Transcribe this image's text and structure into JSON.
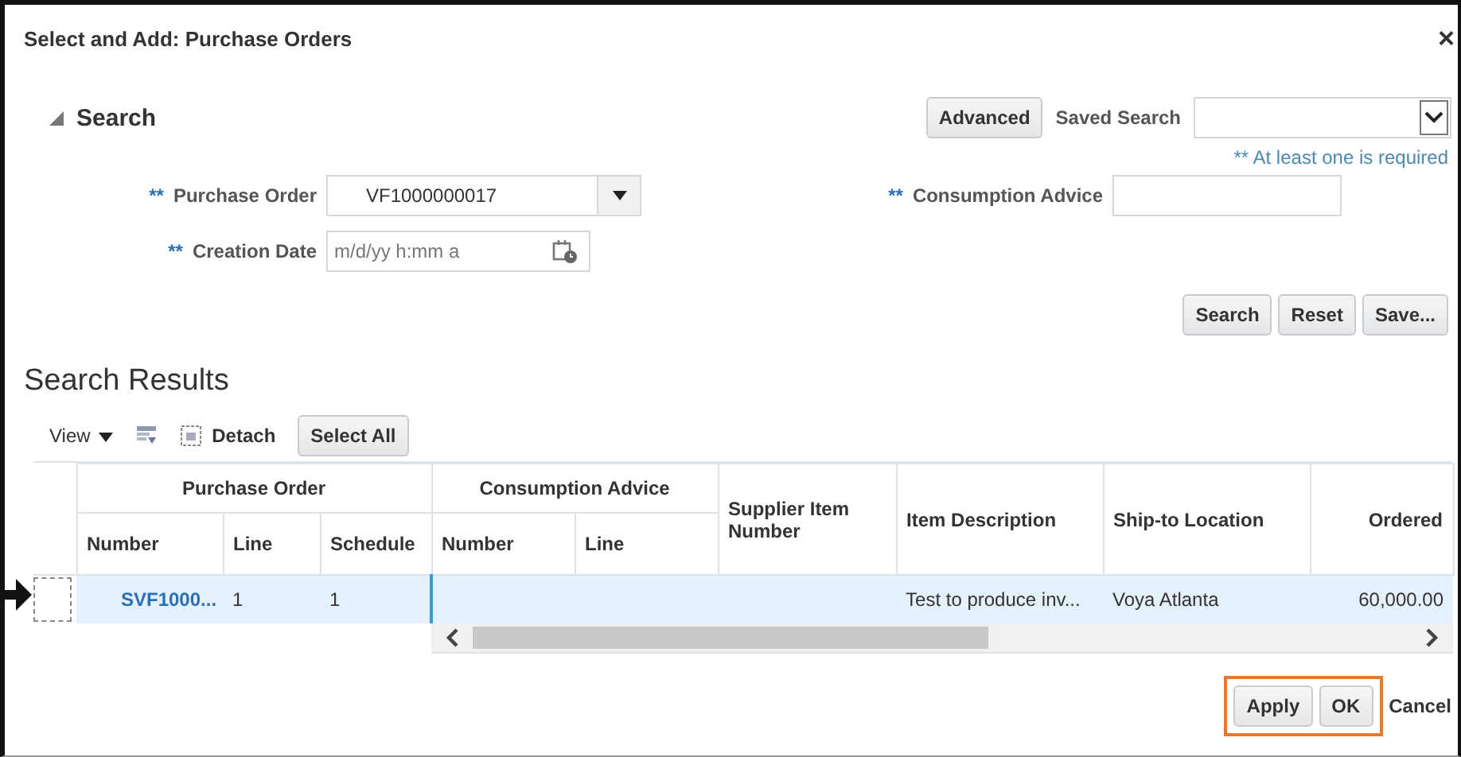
{
  "window": {
    "title": "Select and Add: Purchase Orders",
    "close": "×"
  },
  "search": {
    "title": "Search",
    "expanded": true,
    "advanced": "Advanced",
    "saved_search_label": "Saved Search",
    "required_note": "** At least one is required",
    "fields": [
      {
        "kind": "combo",
        "marker": "**",
        "label": "Purchase Order",
        "value": "VF1000000017"
      },
      {
        "kind": "date",
        "marker": "**",
        "label": "Creation Date",
        "placeholder": "m/d/yy h:mm a"
      },
      {
        "kind": "text",
        "marker": "**",
        "label": "Consumption Advice"
      }
    ],
    "buttons": [
      "Search",
      "Reset",
      "Save..."
    ]
  },
  "results": {
    "title": "Search Results",
    "toolbar": {
      "view": "View",
      "detach": "Detach",
      "select_all": "Select All"
    },
    "column_groups": [
      {
        "label": "Purchase Order",
        "columns": [
          "Number",
          "Line",
          "Schedule"
        ]
      },
      {
        "label": "Consumption Advice",
        "columns": [
          "Number",
          "Line"
        ]
      },
      {
        "label": "Supplier Item Number"
      },
      {
        "label": "Item Description"
      },
      {
        "label": "Ship-to Location"
      },
      {
        "label": "Ordered",
        "align_right": true
      }
    ],
    "rows": [
      {
        "selected": true,
        "cells": [
          {
            "text": "SVF1000...",
            "kind": "link"
          },
          {
            "text": "1"
          },
          {
            "text": "1"
          },
          null,
          null,
          null,
          {
            "text": "Test to produce inv..."
          },
          {
            "text": "Voya Atlanta"
          },
          {
            "text": "60,000.00",
            "align_right": true
          }
        ]
      }
    ]
  },
  "footer": {
    "buttons": [
      {
        "label": "Apply",
        "kind": "button",
        "highlighted": true
      },
      {
        "label": "OK",
        "kind": "button",
        "highlighted": true
      },
      {
        "label": "Cancel",
        "kind": "plain",
        "highlighted": false
      }
    ]
  }
}
